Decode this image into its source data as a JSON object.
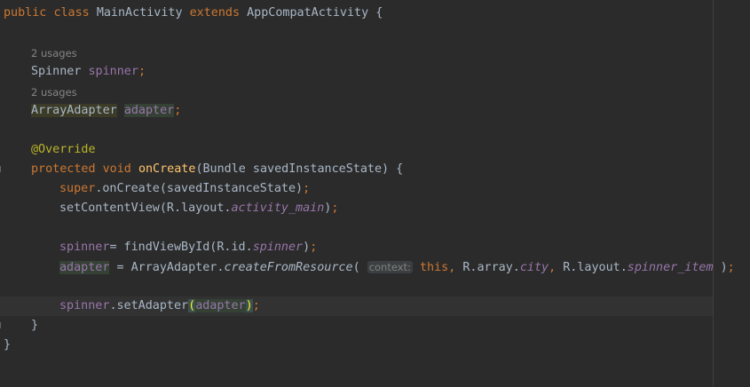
{
  "code": {
    "l1": {
      "kw1": "public",
      "kw2": "class",
      "name": "MainActivity",
      "kw3": "extends",
      "parent": "AppCompatActivity",
      "brace": "{"
    },
    "usages1": "2 usages",
    "l2": {
      "type": "Spinner",
      "var": "spinner",
      "semi": ";"
    },
    "usages2": "2 usages",
    "l3": {
      "type": "ArrayAdapter",
      "var": "adapter",
      "semi": ";"
    },
    "l4": {
      "annotation": "@Override"
    },
    "l5": {
      "kw1": "protected",
      "kw2": "void",
      "fn": "onCreate",
      "params": "(Bundle savedInstanceState) {"
    },
    "l6": {
      "kw": "super",
      "rest": ".onCreate(savedInstanceState)",
      "semi": ";"
    },
    "l7": {
      "pre": "setContentView(R.layout.",
      "field": "activity_main",
      "post": ")",
      "semi": ";"
    },
    "l8": {
      "var": "spinner",
      "mid": "= findViewById(R.id.",
      "field": "spinner",
      "post": ")",
      "semi": ";"
    },
    "l9": {
      "var": "adapter",
      "mid": " = ArrayAdapter.",
      "method": "createFromResource",
      "open": "(",
      "hint": "context:",
      "kw": "this",
      "comma1": ",",
      "r1": " R.array.",
      "f1": "city",
      "comma2": ",",
      "r2": " R.layout.",
      "f2": "spinner_item",
      "close": " )",
      "semi": ";"
    },
    "l10": {
      "var": "spinner",
      "mid": ".setAdapter",
      "open": "(",
      "arg": "adapter",
      "close": ")",
      "semi": ";"
    },
    "l11": {
      "brace": "}"
    },
    "l12": {
      "brace": "}"
    }
  }
}
